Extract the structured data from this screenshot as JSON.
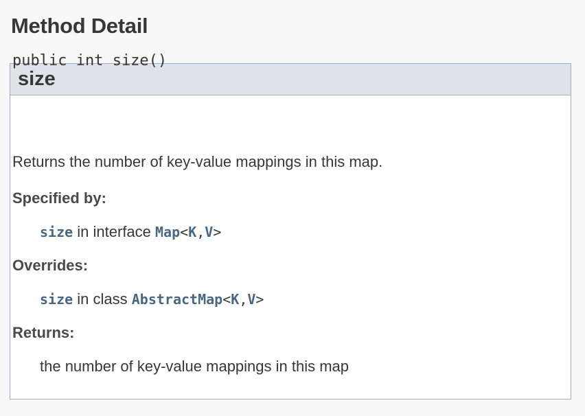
{
  "page": {
    "section_title": "Method Detail"
  },
  "method": {
    "name": "size",
    "signature": "public int size()",
    "description": "Returns the number of key-value mappings in this map.",
    "specified_by": {
      "label": "Specified by:",
      "method_link": "size",
      "text": " in interface ",
      "type_link": "Map",
      "lt": "<",
      "param1": "K",
      "comma": ",",
      "param2": "V",
      "gt": ">"
    },
    "overrides": {
      "label": "Overrides:",
      "method_link": "size",
      "text": " in class ",
      "type_link": "AbstractMap",
      "lt": "<",
      "param1": "K",
      "comma": ",",
      "param2": "V",
      "gt": ">"
    },
    "returns": {
      "label": "Returns:",
      "text": "the number of key-value mappings in this map"
    }
  },
  "colors": {
    "link": "#4a6782",
    "header_bg": "#dee3e9",
    "border": "#9eadc0"
  }
}
